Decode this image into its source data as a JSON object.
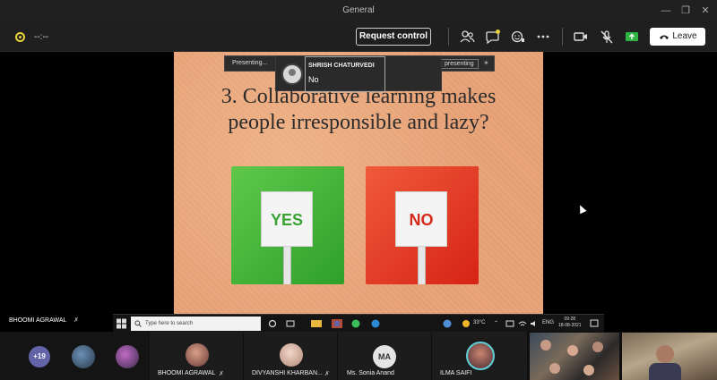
{
  "window": {
    "title": "General"
  },
  "toolbar": {
    "timer": "--:--",
    "request_control_label": "Request control",
    "leave_label": "Leave"
  },
  "slide": {
    "question_line1": "3. Collaborative learning makes",
    "question_line2": "people irresponsible and lazy?",
    "yes_label": "YES",
    "no_label": "NO"
  },
  "presenting_bar": {
    "status_left": "Presenting...",
    "status_right": "presenting"
  },
  "chat_popup": {
    "sender": "SHRISH CHATURVEDI",
    "message": "No"
  },
  "presenter": {
    "name": "BHOOMI AGRAWAL"
  },
  "remote_taskbar": {
    "search_placeholder": "Type here to search",
    "temperature": "33°C",
    "language": "ENG",
    "time": "09:28",
    "date": "18-08-2021"
  },
  "participants": {
    "overflow_count": "+19",
    "tiles": [
      {
        "name": "BHOOMI AGRAWAL"
      },
      {
        "name": "DIVYANSHI KHARBAN..."
      },
      {
        "name": "Ms. Sonia Anand",
        "initials": "MA"
      },
      {
        "name": "ILMA SAIFI"
      }
    ]
  },
  "colors": {
    "accent": "#6264a7",
    "slide_background": "#e9a479",
    "yes_green": "#3aa335",
    "no_red": "#d42b1a",
    "share_active": "#2fb344"
  }
}
